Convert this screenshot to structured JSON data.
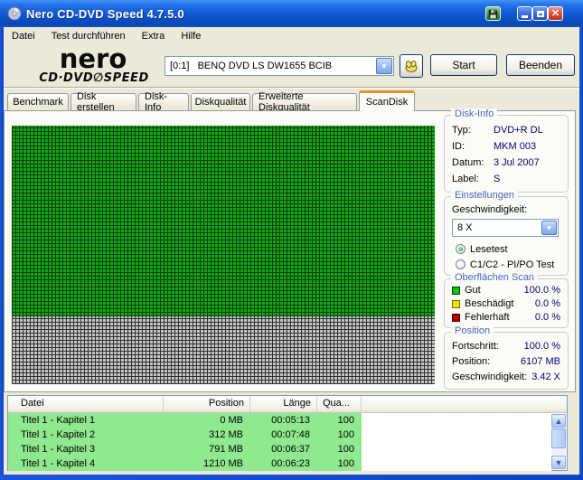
{
  "window": {
    "title": "Nero CD-DVD Speed 4.7.5.0"
  },
  "icons": {
    "app": "cd-disc",
    "capture": "floppy-disk",
    "minimize": "_",
    "maximize": "□",
    "close": "✕",
    "eject": "hand",
    "combo_arrow": "▼",
    "scroll_up": "▲",
    "scroll_down": "▼"
  },
  "menu": {
    "items": [
      "Datei",
      "Test durchführen",
      "Extra",
      "Hilfe"
    ]
  },
  "toolbar": {
    "logo_line1": "nero",
    "logo_line2": "CD·DVD∅SPEED",
    "drive_value": "[0:1]   BENQ DVD LS DW1655 BCIB",
    "start_button": "Start",
    "quit_button": "Beenden"
  },
  "tabs": [
    {
      "label": "Benchmark",
      "active": false
    },
    {
      "label": "Disk erstellen",
      "active": false
    },
    {
      "label": "Disk-Info",
      "active": false
    },
    {
      "label": "Diskqualität",
      "active": false
    },
    {
      "label": "Erweiterte Diskqualität",
      "active": false
    },
    {
      "label": "ScanDisk",
      "active": true
    }
  ],
  "disk_info": {
    "title": "Disk-Info",
    "fields": [
      {
        "label": "Typ:",
        "value": "DVD+R DL"
      },
      {
        "label": "ID:",
        "value": "MKM 003"
      },
      {
        "label": "Datum:",
        "value": "3 Jul 2007"
      },
      {
        "label": "Label:",
        "value": "S"
      }
    ]
  },
  "einstellungen": {
    "title": "Einstellungen",
    "speed_label": "Geschwindigkeit:",
    "speed_value": "8 X",
    "options": [
      {
        "label": "Lesetest",
        "selected": true
      },
      {
        "label": "C1/C2 - PI/PO Test",
        "selected": false
      }
    ]
  },
  "oberflaechen_scan": {
    "title": "Oberflächen Scan",
    "rows": [
      {
        "label": "Gut",
        "value": "100.0 %",
        "color": "#00C800"
      },
      {
        "label": "Beschädigt",
        "value": "0.0 %",
        "color": "#EAE400"
      },
      {
        "label": "Fehlerhaft",
        "value": "0.0 %",
        "color": "#B40000"
      }
    ]
  },
  "position_panel": {
    "title": "Position",
    "rows": [
      {
        "label": "Fortschritt:",
        "value": "100.0 %"
      },
      {
        "label": "Position:",
        "value": "6107 MB"
      },
      {
        "label": "Geschwindigkeit:",
        "value": "3.42 X"
      }
    ]
  },
  "scan_grid": {
    "good_color": "#12A812",
    "unscanned_color": "#C6C6C6",
    "good_fraction": 0.74
  },
  "file_table": {
    "headers": [
      "Datei",
      "Position",
      "Länge",
      "Qua..."
    ],
    "rows": [
      [
        "Titel 1 - Kapitel 1",
        "0 MB",
        "00:05:13",
        "100"
      ],
      [
        "Titel 1 - Kapitel 2",
        "312 MB",
        "00:07:48",
        "100"
      ],
      [
        "Titel 1 - Kapitel 3",
        "791 MB",
        "00:06:37",
        "100"
      ],
      [
        "Titel 1 - Kapitel 4",
        "1210 MB",
        "00:06:23",
        "100"
      ]
    ]
  }
}
